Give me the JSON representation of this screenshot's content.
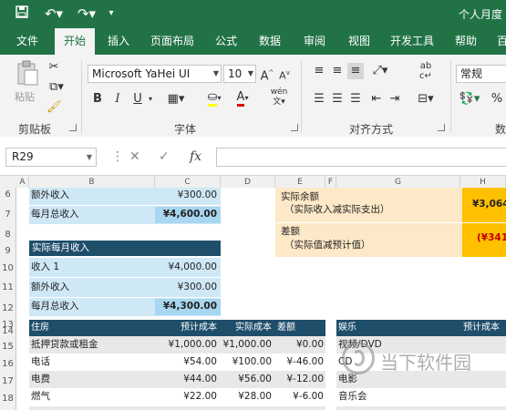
{
  "title_bar": {
    "doc_title": "个人月度",
    "qat_icons": [
      "save-icon",
      "undo-icon",
      "redo-icon",
      "customize-icon"
    ]
  },
  "tabs": [
    "文件",
    "开始",
    "插入",
    "页面布局",
    "公式",
    "数据",
    "审阅",
    "视图",
    "开发工具",
    "帮助",
    "百"
  ],
  "active_tab": "开始",
  "ribbon": {
    "clipboard": {
      "label": "剪贴板",
      "paste_label": "粘贴"
    },
    "font": {
      "label": "字体",
      "font_name": "Microsoft YaHei UI",
      "font_size": "10",
      "bold": "B",
      "italic": "I",
      "underline": "U",
      "phonetic": "wén"
    },
    "alignment": {
      "label": "对齐方式"
    },
    "number": {
      "label": "数",
      "format": "常规",
      "percent": "%"
    }
  },
  "formula_bar": {
    "name_box": "R29",
    "fx": "fx",
    "formula": ""
  },
  "columns": [
    "A",
    "B",
    "C",
    "D",
    "E",
    "F",
    "G",
    "H"
  ],
  "rows": [
    "6",
    "7",
    "8",
    "9",
    "10",
    "11",
    "12",
    "13",
    "14",
    "15",
    "16",
    "17",
    "18"
  ],
  "income_top": [
    {
      "label": "额外收入",
      "value": "¥300.00"
    },
    {
      "label": "每月总收入",
      "value": "¥4,600.00"
    }
  ],
  "actual_income": {
    "header": "实际每月收入",
    "rows": [
      {
        "label": "收入 1",
        "value": "¥4,000.00"
      },
      {
        "label": "额外收入",
        "value": "¥300.00"
      },
      {
        "label": "每月总收入",
        "value": "¥4,300.00"
      }
    ]
  },
  "summary": {
    "balance_label": "实际余额",
    "balance_sub": "（实际收入减实际支出）",
    "balance_value": "¥3,064.",
    "diff_label": "差额",
    "diff_sub": "（实际值减预计值）",
    "diff_value": "(¥341."
  },
  "housing": {
    "headers": [
      "住房",
      "预计成本",
      "实际成本",
      "差额"
    ],
    "rows": [
      [
        "抵押贷款或租金",
        "¥1,000.00",
        "¥1,000.00",
        "¥0.00"
      ],
      [
        "电话",
        "¥54.00",
        "¥100.00",
        "¥-46.00"
      ],
      [
        "电费",
        "¥44.00",
        "¥56.00",
        "¥-12.00"
      ],
      [
        "燃气",
        "¥22.00",
        "¥28.00",
        "¥-6.00"
      ]
    ]
  },
  "entertainment": {
    "headers": [
      "娱乐",
      "预计成本"
    ],
    "rows": [
      "视频/DVD",
      "CD",
      "电影",
      "音乐会"
    ]
  },
  "watermark": "当下软件园",
  "colors": {
    "excel_green": "#217346",
    "header_navy": "#1f4e6b",
    "light_blue": "#cfe8f5",
    "total_blue": "#a9d6f0",
    "orange": "#ffc000",
    "light_orange": "#fde9c7",
    "red": "#c00000"
  }
}
